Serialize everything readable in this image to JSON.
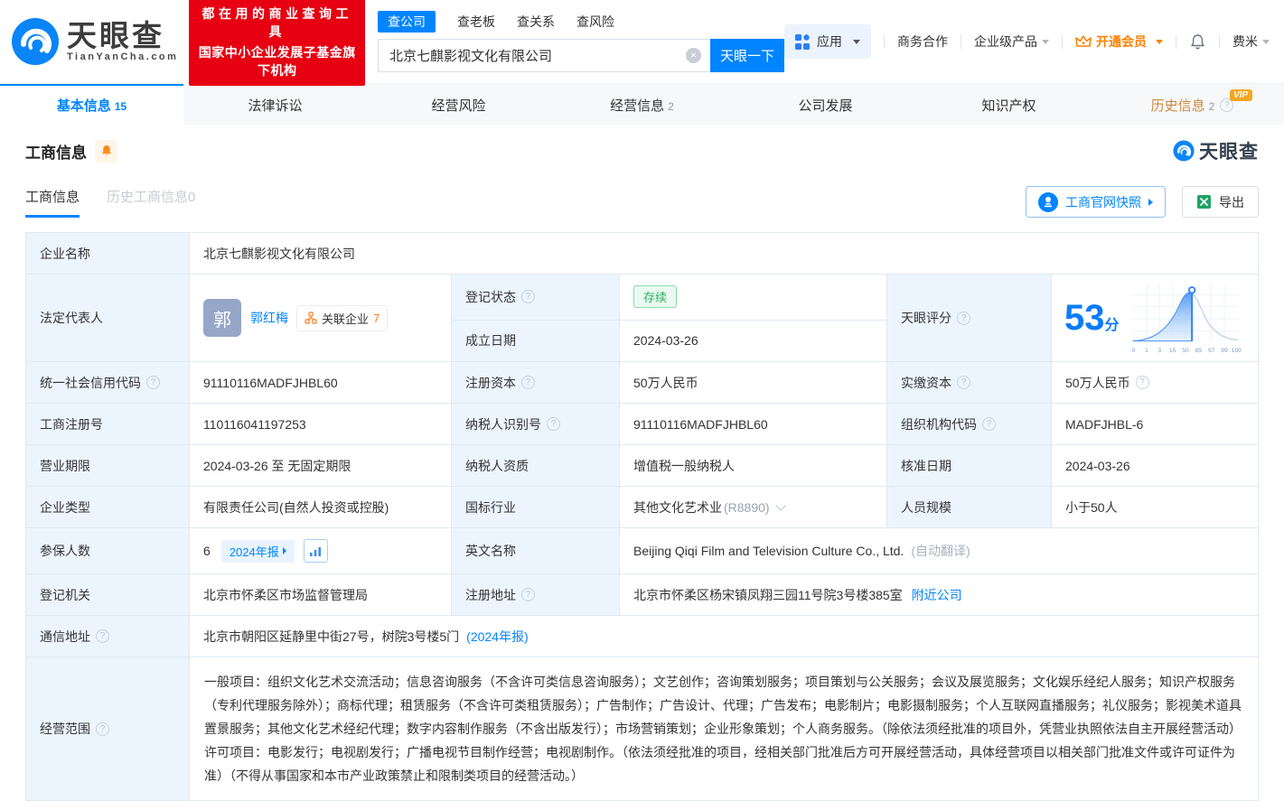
{
  "brand": {
    "name": "天眼查",
    "domain": "TianYanCha.com",
    "slogan1": "都在用的商业查询工具",
    "slogan2": "国家中小企业发展子基金旗下机构"
  },
  "search": {
    "tabs": [
      "查公司",
      "查老板",
      "查关系",
      "查风险"
    ],
    "value": "北京七麒影视文化有限公司",
    "button": "天眼一下"
  },
  "topnav": {
    "apps": "应用",
    "biz": "商务合作",
    "enterprise": "企业级产品",
    "vip": "开通会员",
    "user": "费米"
  },
  "tabs": [
    {
      "label": "基本信息",
      "count": "15"
    },
    {
      "label": "法律诉讼",
      "count": ""
    },
    {
      "label": "经营风险",
      "count": ""
    },
    {
      "label": "经营信息",
      "count": "2"
    },
    {
      "label": "公司发展",
      "count": ""
    },
    {
      "label": "知识产权",
      "count": ""
    },
    {
      "label": "历史信息",
      "count": "2",
      "vip": "VIP"
    }
  ],
  "section": {
    "title": "工商信息",
    "subtab_active": "工商信息",
    "subtab_history": "历史工商信息",
    "subtab_history_count": "0",
    "snapshot": "工商官网快照",
    "export": "导出",
    "watermark": "天眼查"
  },
  "fields": {
    "company_name": {
      "label": "企业名称",
      "value": "北京七麒影视文化有限公司"
    },
    "legal_rep": {
      "label": "法定代表人",
      "avatar": "郭",
      "name": "郭红梅",
      "related": "关联企业",
      "related_count": "7"
    },
    "reg_status": {
      "label": "登记状态",
      "value": "存续"
    },
    "est_date": {
      "label": "成立日期",
      "value": "2024-03-26"
    },
    "score": {
      "label": "天眼评分",
      "value": "53",
      "unit": "分",
      "ticks": [
        "0",
        "1",
        "3",
        "15",
        "50",
        "85",
        "97",
        "99",
        "100"
      ]
    },
    "credit_code": {
      "label": "统一社会信用代码",
      "value": "91110116MADFJHBL60"
    },
    "reg_capital": {
      "label": "注册资本",
      "value": "50万人民币"
    },
    "paid_capital": {
      "label": "实缴资本",
      "value": "50万人民币"
    },
    "reg_no": {
      "label": "工商注册号",
      "value": "110116041197253"
    },
    "taxpayer_no": {
      "label": "纳税人识别号",
      "value": "91110116MADFJHBL60"
    },
    "org_code": {
      "label": "组织机构代码",
      "value": "MADFJHBL-6"
    },
    "term": {
      "label": "营业期限",
      "value": "2024-03-26 至 无固定期限"
    },
    "taxpayer_quality": {
      "label": "纳税人资质",
      "value": "增值税一般纳税人"
    },
    "approve_date": {
      "label": "核准日期",
      "value": "2024-03-26"
    },
    "company_type": {
      "label": "企业类型",
      "value": "有限责任公司(自然人投资或控股)"
    },
    "industry": {
      "label": "国标行业",
      "value": "其他文化艺术业",
      "code": "(R8890)"
    },
    "staff": {
      "label": "人员规模",
      "value": "小于50人"
    },
    "insured": {
      "label": "参保人数",
      "value": "6",
      "report": "2024年报"
    },
    "en_name": {
      "label": "英文名称",
      "value": "Beijing Qiqi Film and Television Culture Co., Ltd.",
      "note": "(自动翻译)"
    },
    "authority": {
      "label": "登记机关",
      "value": "北京市怀柔区市场监督管理局"
    },
    "address": {
      "label": "注册地址",
      "value": "北京市怀柔区杨宋镇凤翔三园11号院3号楼385室",
      "nearby": "附近公司"
    },
    "mail_address": {
      "label": "通信地址",
      "value": "北京市朝阳区延静里中街27号，树院3号楼5门",
      "report": "(2024年报)"
    },
    "scope": {
      "label": "经营范围",
      "value": "一般项目：组织文化艺术交流活动；信息咨询服务（不含许可类信息咨询服务）；文艺创作；咨询策划服务；项目策划与公关服务；会议及展览服务；文化娱乐经纪人服务；知识产权服务（专利代理服务除外）；商标代理；租赁服务（不含许可类租赁服务）；广告制作；广告设计、代理；广告发布；电影制片；电影摄制服务；个人互联网直播服务；礼仪服务；影视美术道具置景服务；其他文化艺术经纪代理；数字内容制作服务（不含出版发行）；市场营销策划；企业形象策划；个人商务服务。（除依法须经批准的项目外，凭营业执照依法自主开展经营活动）许可项目：电影发行；电视剧发行；广播电视节目制作经营；电视剧制作。（依法须经批准的项目，经相关部门批准后方可开展经营活动，具体经营项目以相关部门批准文件或许可证件为准）（不得从事国家和本市产业政策禁止和限制类项目的经营活动。）"
    }
  },
  "colors": {
    "accent": "#0084ff",
    "banner_red": "#e60012",
    "vip_orange": "#ff8000",
    "status_green": "#2baf5c",
    "history_tab": "#c9883f"
  }
}
